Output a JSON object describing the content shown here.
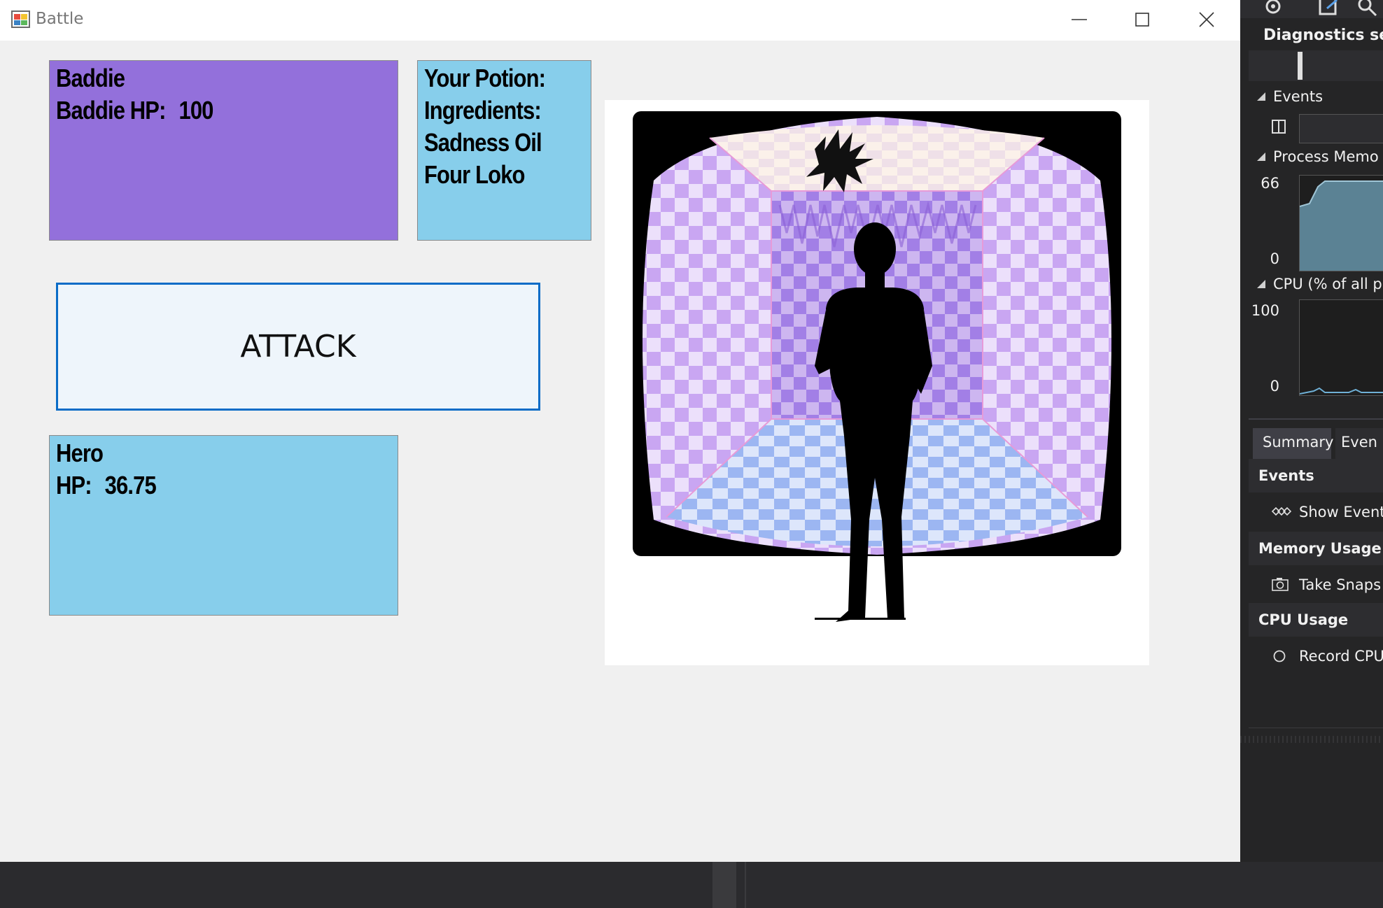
{
  "window": {
    "title": "Battle"
  },
  "baddie": {
    "name": "Baddie",
    "hp_label": "Baddie HP:",
    "hp_value": "100"
  },
  "potion": {
    "line1": "Your Potion:",
    "line2": "Ingredients:",
    "line3": "Sadness Oil",
    "line4": "Four Loko"
  },
  "attack": {
    "label": "ATTACK"
  },
  "hero": {
    "name": "Hero",
    "hp_label": "HP:",
    "hp_value": "36.75"
  },
  "diagnostics": {
    "session_label": "Diagnostics sess",
    "events_section": "Events",
    "process_memory_section": "Process Memo",
    "memory_axis_max": "66",
    "memory_axis_min": "0",
    "cpu_section": "CPU (% of all p",
    "cpu_axis_max": "100",
    "cpu_axis_min": "0",
    "tabs": [
      "Summary",
      "Even"
    ],
    "summary_events_header": "Events",
    "show_events_label": "Show Event",
    "memory_usage_header": "Memory Usage",
    "take_snapshot_label": "Take Snaps",
    "cpu_usage_header": "CPU Usage",
    "record_cpu_label": "Record CPU"
  },
  "colors": {
    "baddie_panel": "#9370db",
    "potion_panel": "#87ceeb",
    "hero_panel": "#87ceeb",
    "attack_border": "#0a6cc7",
    "window_bg": "#f0f0f0",
    "diag_bg": "#252526"
  }
}
